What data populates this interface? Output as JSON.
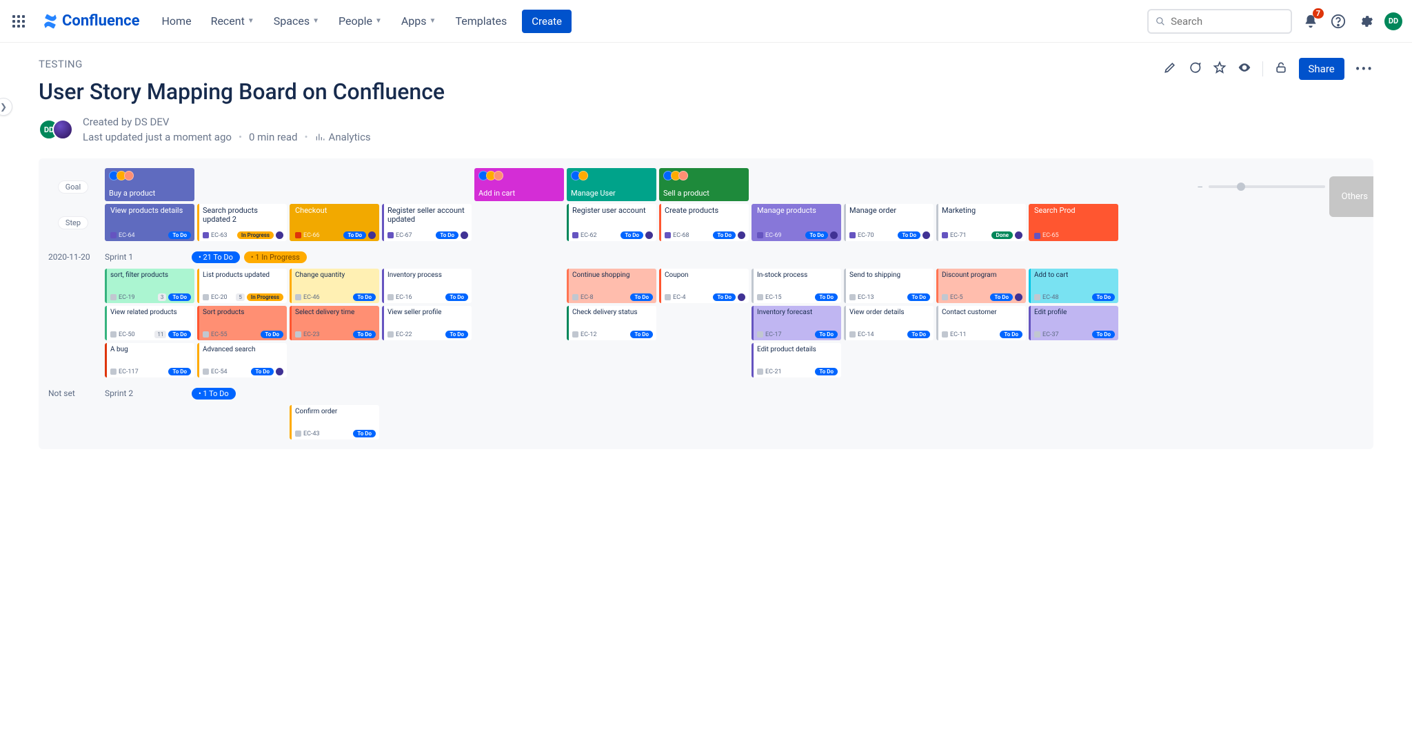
{
  "brand": "Confluence",
  "nav": {
    "home": "Home",
    "recent": "Recent",
    "spaces": "Spaces",
    "people": "People",
    "apps": "Apps",
    "templates": "Templates",
    "create": "Create"
  },
  "search_placeholder": "Search",
  "notif_count": "7",
  "avatar": "DD",
  "breadcrumb": "TESTING",
  "title": "User Story Mapping Board on Confluence",
  "byline": {
    "created": "Created by DS DEV",
    "updated": "Last updated just a moment ago",
    "read": "0 min read",
    "analytics": "Analytics"
  },
  "share": "Share",
  "labels": {
    "goal": "Goal",
    "step": "Step"
  },
  "others": "Others",
  "goals": [
    {
      "col": 1,
      "title": "Buy a product",
      "bg": "#5F6BBF"
    },
    {
      "col": 5,
      "title": "Add in cart",
      "bg": "#D42DD6"
    },
    {
      "col": 6,
      "title": "Manage User",
      "bg": "#00A38A"
    },
    {
      "col": 7,
      "title": "Sell a product",
      "bg": "#1E8A3B"
    }
  ],
  "steps": [
    {
      "col": 1,
      "title": "View products details",
      "key": "EC-64",
      "status": "To Do",
      "bg": "#5F6BBF",
      "border": "#5F6BBF",
      "keyIc": "#6554C0",
      "white": true
    },
    {
      "col": 2,
      "title": "Search products updated 2",
      "key": "EC-63",
      "status": "In Progress",
      "bg": "#FFFFFF",
      "border": "#FFAB00",
      "keyIc": "#6554C0",
      "av": true
    },
    {
      "col": 3,
      "title": "Checkout",
      "key": "EC-66",
      "status": "To Do",
      "bg": "#F2A900",
      "border": "#F2A900",
      "keyIc": "#DE350B",
      "white": true,
      "av": true
    },
    {
      "col": 4,
      "title": "Register seller account updated",
      "key": "EC-67",
      "status": "To Do",
      "bg": "#FFFFFF",
      "border": "#6554C0",
      "keyIc": "#6554C0",
      "av": true
    },
    {
      "col": 6,
      "title": "Register user account",
      "key": "EC-62",
      "status": "To Do",
      "bg": "#FFFFFF",
      "border": "#00875A",
      "keyIc": "#6554C0",
      "av": true
    },
    {
      "col": 7,
      "title": "Create products",
      "key": "EC-68",
      "status": "To Do",
      "bg": "#FFFFFF",
      "border": "#FF5630",
      "keyIc": "#6554C0",
      "av": true
    },
    {
      "col": 8,
      "title": "Manage products",
      "key": "EC-69",
      "status": "To Do",
      "bg": "#8777D9",
      "border": "#8777D9",
      "keyIc": "#6554C0",
      "white": true,
      "av": true
    },
    {
      "col": 9,
      "title": "Manage order",
      "key": "EC-70",
      "status": "To Do",
      "bg": "#FFFFFF",
      "border": "#C1C7D0",
      "keyIc": "#6554C0",
      "av": true
    },
    {
      "col": 10,
      "title": "Marketing",
      "key": "EC-71",
      "status": "Done",
      "bg": "#FFFFFF",
      "border": "#C1C7D0",
      "keyIc": "#6554C0",
      "av": true
    },
    {
      "col": 11,
      "title": "Search Prod",
      "key": "EC-65",
      "status": "",
      "bg": "#FF5630",
      "border": "#FF5630",
      "keyIc": "#6554C0",
      "white": true
    }
  ],
  "sprint1": {
    "date": "2020-11-20",
    "name": "Sprint 1",
    "pills": [
      {
        "t": "21 To Do",
        "c": "sp-todo"
      },
      {
        "t": "1 In Progress",
        "c": "sp-prog"
      }
    ]
  },
  "s1r1": [
    {
      "col": 1,
      "title": "sort, filter products",
      "key": "EC-19",
      "status": "To Do",
      "bg": "#ABF5D1",
      "border": "#36B37E",
      "cnt": "3"
    },
    {
      "col": 2,
      "title": "List products updated",
      "key": "EC-20",
      "status": "In Progress",
      "bg": "#FFFFFF",
      "border": "#FFAB00",
      "cnt": "5"
    },
    {
      "col": 3,
      "title": "Change quantity",
      "key": "EC-46",
      "status": "To Do",
      "bg": "#FFF0B3",
      "border": "#FFAB00"
    },
    {
      "col": 4,
      "title": "Inventory process",
      "key": "EC-16",
      "status": "To Do",
      "bg": "#FFFFFF",
      "border": "#6554C0"
    },
    {
      "col": 6,
      "title": "Continue shopping",
      "key": "EC-8",
      "status": "To Do",
      "bg": "#FFBDAD",
      "border": "#FF7452"
    },
    {
      "col": 7,
      "title": "Coupon",
      "key": "EC-4",
      "status": "To Do",
      "bg": "#FFFFFF",
      "border": "#FF5630",
      "av": true
    },
    {
      "col": 8,
      "title": "In-stock process",
      "key": "EC-15",
      "status": "To Do",
      "bg": "#FFFFFF",
      "border": "#C1C7D0"
    },
    {
      "col": 9,
      "title": "Send to shipping",
      "key": "EC-13",
      "status": "To Do",
      "bg": "#FFFFFF",
      "border": "#C1C7D0"
    },
    {
      "col": 10,
      "title": "Discount program",
      "key": "EC-5",
      "status": "To Do",
      "bg": "#FFBDAD",
      "border": "#FF7452",
      "av": true
    },
    {
      "col": 11,
      "title": "Add to cart",
      "key": "EC-48",
      "status": "To Do",
      "bg": "#79E2F2",
      "border": "#00C7E6"
    }
  ],
  "s1r2": [
    {
      "col": 1,
      "title": "View related products",
      "key": "EC-50",
      "status": "To Do",
      "bg": "#FFFFFF",
      "border": "#36B37E",
      "cnt": "11"
    },
    {
      "col": 2,
      "title": "Sort products",
      "key": "EC-55",
      "status": "To Do",
      "bg": "#FF8F73",
      "border": "#FF5630"
    },
    {
      "col": 3,
      "title": "Select delivery time",
      "key": "EC-23",
      "status": "To Do",
      "bg": "#FF8F73",
      "border": "#FF5630"
    },
    {
      "col": 4,
      "title": "View seller profile",
      "key": "EC-22",
      "status": "To Do",
      "bg": "#FFFFFF",
      "border": "#6554C0"
    },
    {
      "col": 6,
      "title": "Check delivery status",
      "key": "EC-12",
      "status": "To Do",
      "bg": "#FFFFFF",
      "border": "#00875A"
    },
    {
      "col": 8,
      "title": "Inventory forecast",
      "key": "EC-17",
      "status": "To Do",
      "bg": "#C0B6F2",
      "border": "#6554C0"
    },
    {
      "col": 9,
      "title": "View order details",
      "key": "EC-14",
      "status": "To Do",
      "bg": "#FFFFFF",
      "border": "#C1C7D0"
    },
    {
      "col": 10,
      "title": "Contact customer",
      "key": "EC-11",
      "status": "To Do",
      "bg": "#FFFFFF",
      "border": "#C1C7D0"
    },
    {
      "col": 11,
      "title": "Edit profile",
      "key": "EC-37",
      "status": "To Do",
      "bg": "#C0B6F2",
      "border": "#6554C0"
    }
  ],
  "s1r3": [
    {
      "col": 1,
      "title": "A bug",
      "key": "EC-117",
      "status": "To Do",
      "bg": "#FFFFFF",
      "border": "#DE350B"
    },
    {
      "col": 2,
      "title": "Advanced search",
      "key": "EC-54",
      "status": "To Do",
      "bg": "#FFFFFF",
      "border": "#FFAB00",
      "av": true
    },
    {
      "col": 8,
      "title": "Edit product details",
      "key": "EC-21",
      "status": "To Do",
      "bg": "#FFFFFF",
      "border": "#6554C0"
    }
  ],
  "sprint2": {
    "date": "Not set",
    "name": "Sprint 2",
    "pills": [
      {
        "t": "1 To Do",
        "c": "sp-todo"
      }
    ]
  },
  "s2r1": [
    {
      "col": 3,
      "title": "Confirm order",
      "key": "EC-43",
      "status": "To Do",
      "bg": "#FFFFFF",
      "border": "#FFAB00"
    }
  ]
}
